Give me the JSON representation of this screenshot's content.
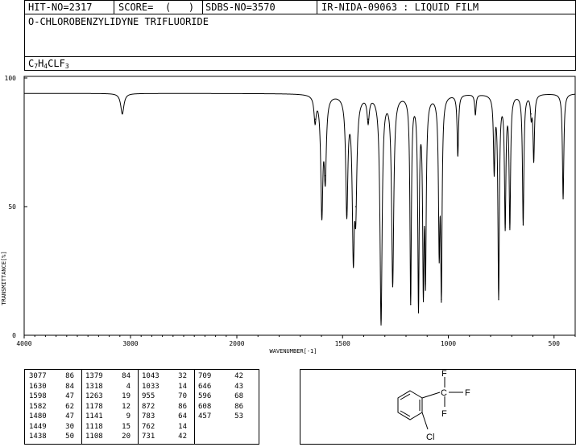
{
  "header": {
    "hit_no": "HIT-NO=2317",
    "score_label": "SCORE=",
    "score_value": "(   )",
    "sdbs_no": "SDBS-NO=3570",
    "ir_method": "IR-NIDA-09063 : LIQUID FILM",
    "compound_name": "O-CHLOROBENZYLIDYNE TRIFLUORIDE",
    "formula": {
      "c": "C",
      "c_n": "7",
      "h": "H",
      "h_n": "4",
      "rest": "CLF",
      "f_n": "3"
    }
  },
  "chart_data": {
    "type": "line",
    "xlabel": "WAVENUMBER[-1]",
    "ylabel": "TRANSMITTANCE[%]",
    "xlim": [
      4000,
      400
    ],
    "ylim": [
      0,
      100
    ],
    "x_ticks": [
      4000,
      3000,
      2000,
      1500,
      1000,
      500
    ],
    "y_ticks": [
      0,
      50,
      100
    ],
    "grid": false,
    "series": [
      {
        "color": "#000000",
        "baseline": 94,
        "peaks": [
          [
            3077,
            86
          ],
          [
            1630,
            84
          ],
          [
            1598,
            47
          ],
          [
            1582,
            62
          ],
          [
            1480,
            47
          ],
          [
            1449,
            30
          ],
          [
            1438,
            50
          ],
          [
            1379,
            84
          ],
          [
            1318,
            4
          ],
          [
            1263,
            19
          ],
          [
            1178,
            12
          ],
          [
            1141,
            9
          ],
          [
            1118,
            15
          ],
          [
            1108,
            20
          ],
          [
            1043,
            32
          ],
          [
            1033,
            14
          ],
          [
            955,
            70
          ],
          [
            872,
            86
          ],
          [
            783,
            64
          ],
          [
            762,
            14
          ],
          [
            731,
            42
          ],
          [
            709,
            42
          ],
          [
            646,
            43
          ],
          [
            596,
            68
          ],
          [
            608,
            86
          ],
          [
            457,
            53
          ]
        ]
      }
    ]
  },
  "peak_table": {
    "columns": [
      [
        [
          "3077",
          "86"
        ],
        [
          "1630",
          "84"
        ],
        [
          "1598",
          "47"
        ],
        [
          "1582",
          "62"
        ],
        [
          "1480",
          "47"
        ],
        [
          "1449",
          "30"
        ],
        [
          "1438",
          "50"
        ]
      ],
      [
        [
          "1379",
          "84"
        ],
        [
          "1318",
          "4"
        ],
        [
          "1263",
          "19"
        ],
        [
          "1178",
          "12"
        ],
        [
          "1141",
          "9"
        ],
        [
          "1118",
          "15"
        ],
        [
          "1108",
          "20"
        ]
      ],
      [
        [
          "1043",
          "32"
        ],
        [
          "1033",
          "14"
        ],
        [
          "955",
          "70"
        ],
        [
          "872",
          "86"
        ],
        [
          "783",
          "64"
        ],
        [
          "762",
          "14"
        ],
        [
          "731",
          "42"
        ]
      ],
      [
        [
          "709",
          "42"
        ],
        [
          "646",
          "43"
        ],
        [
          "596",
          "68"
        ],
        [
          "608",
          "86"
        ],
        [
          "457",
          "53"
        ]
      ]
    ]
  },
  "structure": {
    "atom_f_top": "F",
    "atom_f_right": "F",
    "atom_f_bottom": "F",
    "atom_c": "C",
    "atom_cl": "Cl"
  }
}
